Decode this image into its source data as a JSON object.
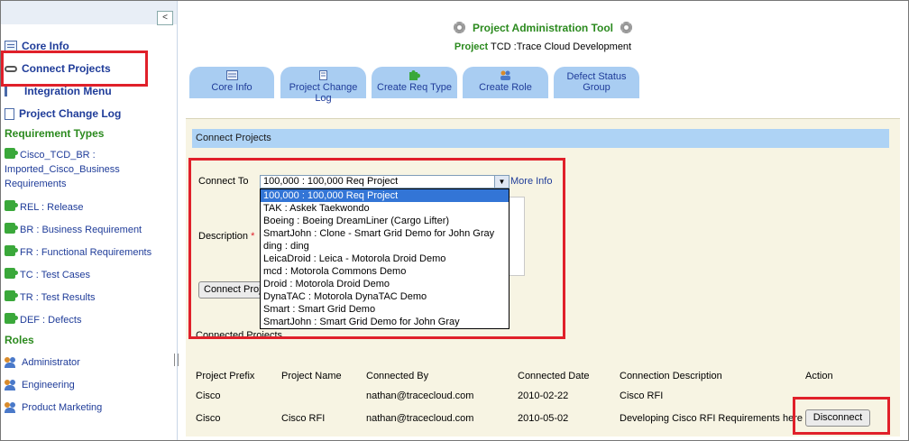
{
  "sidebar": {
    "top_items": [
      {
        "label": "Core Info",
        "icon": "screen-icon"
      },
      {
        "label": "Connect Projects",
        "icon": "chain-icon"
      },
      {
        "label": "Integration Menu",
        "icon": "menu-icon"
      },
      {
        "label": "Project Change Log",
        "icon": "document-icon"
      }
    ],
    "requirement_types_heading": "Requirement Types",
    "requirement_types": [
      {
        "line1": "Cisco_TCD_BR :",
        "line2": "Imported_Cisco_Business",
        "line3": "Requirements"
      },
      {
        "line1": "REL : Release"
      },
      {
        "line1": "BR : Business Requirement"
      },
      {
        "line1": "FR : Functional Requirements"
      },
      {
        "line1": "TC : Test Cases"
      },
      {
        "line1": "TR : Test Results"
      },
      {
        "line1": "DEF : Defects"
      }
    ],
    "roles_heading": "Roles",
    "roles": [
      "Administrator",
      "Engineering",
      "Product Marketing"
    ],
    "collapse_label": "<"
  },
  "header": {
    "title": "Project Administration Tool",
    "project_label": "Project",
    "project_value": "TCD :Trace Cloud Development"
  },
  "tabs": [
    {
      "label": "Core Info"
    },
    {
      "label": "Project Change Log"
    },
    {
      "label": "Create Req Type"
    },
    {
      "label": "Create Role"
    },
    {
      "label": "Defect Status",
      "label2": "Group"
    }
  ],
  "section": {
    "title": "Connect Projects",
    "connect_to_label": "Connect To",
    "connect_to_value": "100,000 : 100,000 Req Project",
    "more_info": "More Info",
    "description_label": "Description",
    "required_mark": "*",
    "connect_button": "Connect Proj",
    "connected_projects_heading": "Connected Projects",
    "dropdown_options": [
      "100,000 : 100,000 Req Project",
      "TAK : Askek Taekwondo",
      "Boeing : Boeing DreamLiner (Cargo Lifter)",
      "SmartJohn : Clone - Smart Grid Demo for John Gray",
      "ding : ding",
      "LeicaDroid : Leica - Motorola Droid Demo",
      "mcd : Motorola Commons Demo",
      "Droid : Motorola Droid Demo",
      "DynaTAC : Motorola DynaTAC Demo",
      "Smart : Smart Grid Demo",
      "SmartJohn : Smart Grid Demo for John Gray"
    ]
  },
  "table": {
    "headers": [
      "Project Prefix",
      "Project Name",
      "Connected By",
      "Connected Date",
      "Connection Description",
      "Action"
    ],
    "rows": [
      [
        "Cisco",
        "",
        "nathan@tracecloud.com",
        "2010-02-22",
        "Cisco RFI",
        ""
      ],
      [
        "Cisco",
        "Cisco RFI",
        "nathan@tracecloud.com",
        "2010-05-02",
        "Developing Cisco RFI Requirements here",
        "Disconnect"
      ]
    ]
  },
  "colors": {
    "highlight": "#e0202a",
    "tab_bg": "#a9cdf2",
    "heading_green": "#2b8a1e",
    "link_blue": "#1f3c99",
    "panel_bg": "#f7f4e3"
  }
}
